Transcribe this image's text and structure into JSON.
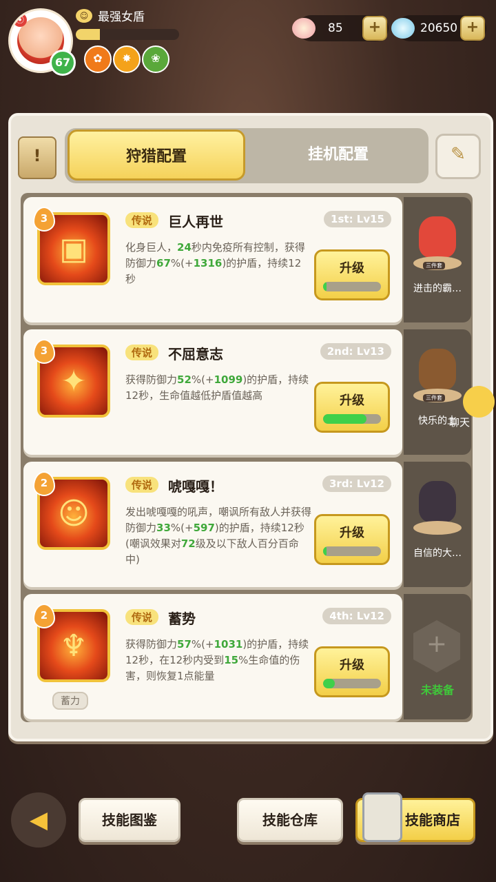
{
  "player": {
    "name": "最强女盾",
    "level": "67",
    "xp_fraction": 0.23,
    "badges": [
      "✿",
      "✸",
      "❀"
    ],
    "rec_icon": "⦿"
  },
  "resources": {
    "shells": "85",
    "gems": "20650",
    "plus": "+"
  },
  "tabs": {
    "active": "狩猎配置",
    "inactive": "挂机配置"
  },
  "skills": [
    {
      "rank_num": "3",
      "tag": "传说",
      "name": "巨人再世",
      "rank": "1st: Lv15",
      "progress": 0.05,
      "desc": [
        {
          "t": "化身巨人，"
        },
        {
          "t": "24",
          "g": 1
        },
        {
          "t": "秒内免疫所有控制，获得防御力"
        },
        {
          "t": "67",
          "g": 1
        },
        {
          "t": "%(+"
        },
        {
          "t": "1316",
          "g": 1
        },
        {
          "t": ")的护盾，持续12秒"
        }
      ],
      "icon": "▣"
    },
    {
      "rank_num": "3",
      "tag": "传说",
      "name": "不屈意志",
      "rank": "2nd: Lv13",
      "progress": 0.75,
      "desc": [
        {
          "t": "获得防御力"
        },
        {
          "t": "52",
          "g": 1
        },
        {
          "t": "%(+"
        },
        {
          "t": "1099",
          "g": 1
        },
        {
          "t": ")的护盾，持续12秒，生命值越低护盾值越高"
        }
      ],
      "icon": "✦"
    },
    {
      "rank_num": "2",
      "tag": "传说",
      "name": "唬嘎嘎！",
      "rank": "3rd: Lv12",
      "progress": 0.05,
      "desc": [
        {
          "t": "发出唬嘎嘎的吼声，嘲讽所有敌人并获得防御力"
        },
        {
          "t": "33",
          "g": 1
        },
        {
          "t": "%(+"
        },
        {
          "t": "597",
          "g": 1
        },
        {
          "t": ")的护盾，持续12秒(嘲讽效果对"
        },
        {
          "t": "72",
          "g": 1
        },
        {
          "t": "级及以下敌人百分百命中)"
        }
      ],
      "icon": "☺"
    },
    {
      "rank_num": "2",
      "tag": "传说",
      "name": "蓄势",
      "rank": "4th: Lv12",
      "progress": 0.2,
      "sublabel": "蓄力",
      "desc": [
        {
          "t": "获得防御力"
        },
        {
          "t": "57",
          "g": 1
        },
        {
          "t": "%(+"
        },
        {
          "t": "1031",
          "g": 1
        },
        {
          "t": ")的护盾，持续12秒，在12秒内受到"
        },
        {
          "t": "15",
          "g": 1
        },
        {
          "t": "%生命值的伤害，则恢复1点能量"
        }
      ],
      "icon": "♆"
    }
  ],
  "upgrade_label": "升级",
  "pets": [
    {
      "name": "进击的霸…",
      "stamp": "三件套",
      "color": "#e2483a"
    },
    {
      "name": "快乐的土",
      "stamp": "三件套",
      "color": "#8a5a30"
    },
    {
      "name": "自信的大…",
      "stamp": "",
      "color": "#3e3440"
    },
    {
      "empty": true,
      "label": "未装备"
    }
  ],
  "chat_label": "聊天",
  "bottom": {
    "catalog": "技能图鉴",
    "warehouse": "技能仓库",
    "shop": "技能商店"
  },
  "colors": {
    "accent_gold": "#f3cf48",
    "progress_green": "#3fd04a",
    "value_green": "#3fa83a"
  }
}
